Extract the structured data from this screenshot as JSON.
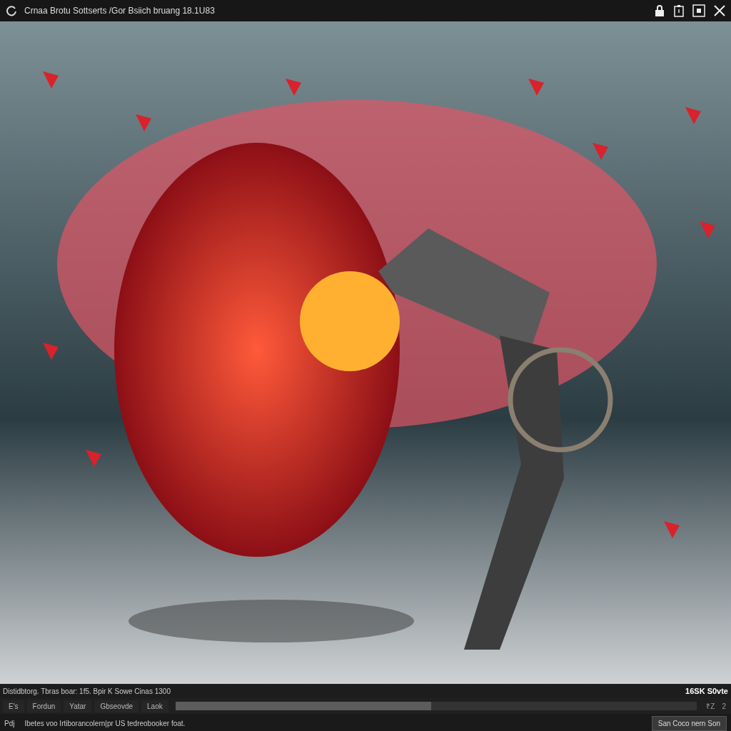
{
  "window": {
    "title": "Crnaa Brotu Sottserts /Gor Bsiich bruang 18.1U83"
  },
  "status_bar": {
    "info": "Distidbtorg. Tbras boar: 1f5. Bpir K Sowe Cinas 1300",
    "size": "16SK S0vte"
  },
  "toolbar": {
    "buttons": [
      "E's",
      "Fordun",
      "Yatar",
      "Gbseovde",
      "Laok"
    ],
    "progress": {
      "level": 0.49
    },
    "counters": [
      "₹Z",
      "2"
    ]
  },
  "footer": {
    "label": "Pdj",
    "message": "Ibetes voo Irtiborancolern|pr US tedreobooker foat.",
    "action": "San Coco nern Son"
  }
}
